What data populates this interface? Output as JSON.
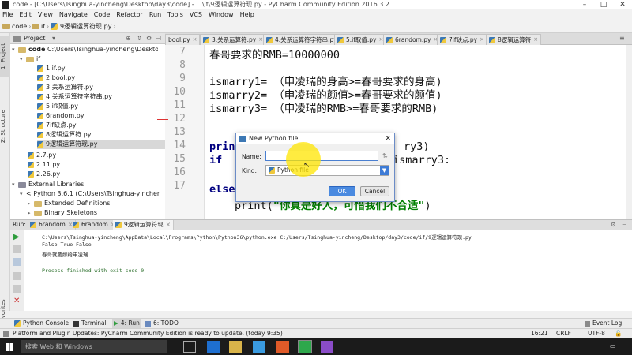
{
  "titlebar": {
    "title": "code - [C:\\Users\\Tsinghua-yincheng\\Desktop\\day3\\code] - ...\\if\\9逻辑运算符现.py - PyCharm Community Edition 2016.3.2",
    "minimize": "–",
    "maximize": "□",
    "close": "✕"
  },
  "menu": [
    "File",
    "Edit",
    "View",
    "Navigate",
    "Code",
    "Refactor",
    "Run",
    "Tools",
    "VCS",
    "Window",
    "Help"
  ],
  "breadcrumb": [
    "code",
    "if",
    "9逻辑运算符现.py"
  ],
  "project_panel": {
    "title": "Project",
    "root": "code",
    "root_path": "C:\\Users\\Tsinghua-yincheng\\Desktop\\day3\\c",
    "folder": "if",
    "files": [
      "1.if.py",
      "2.bool.py",
      "3.关系运算符.py",
      "4.关系运算符字符串.py",
      "5.if取值.py",
      "6random.py",
      "7if缺点.py",
      "8逻辑运算符.py",
      "9逻辑运算符现.py"
    ],
    "root_files": [
      "2.7.py",
      "2.11.py",
      "2.26.py"
    ],
    "external": "External Libraries",
    "python": "< Python 3.6.1 (C:\\Users\\Tsinghua-yincheng\\Ap",
    "ext_defs": "Extended Definitions",
    "binary": "Binary Skeletons"
  },
  "editor_tabs": [
    "bool.py",
    "3.关系运算符.py",
    "4.关系运算符字符串.py",
    "5.if取值.py",
    "6random.py",
    "7if缺点.py",
    "8逻辑运算符"
  ],
  "editor": {
    "line_numbers": [
      "7",
      "8",
      "9",
      "10",
      "11",
      "12",
      "13",
      "14",
      "15",
      "16",
      "17"
    ],
    "line7": "春哥要求的RMB=10000000",
    "line9_a": "ismarry1=  （申凌瑞的身高>=春哥要求的身高)",
    "line10_a": "ismarry2=  （申凌瑞的颜值>=春哥要求的颜值)",
    "line11_a": "ismarry3=  （申凌瑞的RMB>=春哥要求的RMB)",
    "print_kw": "print",
    "print_tail": "ry3)",
    "if_kw": "if",
    "if_tail": "ismarry3:",
    "else_kw": "else",
    "last_print": "print(",
    "last_str": "\"你真是好人，可惜我们不合适\"",
    "last_close": ")"
  },
  "dialog": {
    "title": "New Python file",
    "name_label": "Name:",
    "name_value": "",
    "kind_label": "Kind:",
    "kind_value": "Python file",
    "ok": "OK",
    "cancel": "Cancel"
  },
  "run_panel": {
    "label": "Run:",
    "tabs": [
      "6random",
      "6random",
      "9逻辑运算符现"
    ],
    "console": [
      "C:\\Users\\Tsinghua-yincheng\\AppData\\Local\\Programs\\Python\\Python36\\python.exe C:/Users/Tsinghua-yincheng/Desktop/day3/code/if/9逻辑运算符现.py",
      "False True False",
      "春哥就要嫁给申凌瑞",
      "",
      "Process finished with exit code 0"
    ]
  },
  "bottom_tools": [
    "Python Console",
    "Terminal",
    "4: Run",
    "6: TODO",
    "Event Log"
  ],
  "status": {
    "message": "Platform and Plugin Updates: PyCharm Community Edition is ready to update. (today 9:35)",
    "position": "16:21",
    "line_sep": "CRLF",
    "encoding": "UTF-8"
  },
  "taskbar": {
    "search": "搜索 Web 和 Windows"
  },
  "left_vtabs": [
    "1: Project",
    "Z: Structure",
    "2: Favorites"
  ]
}
